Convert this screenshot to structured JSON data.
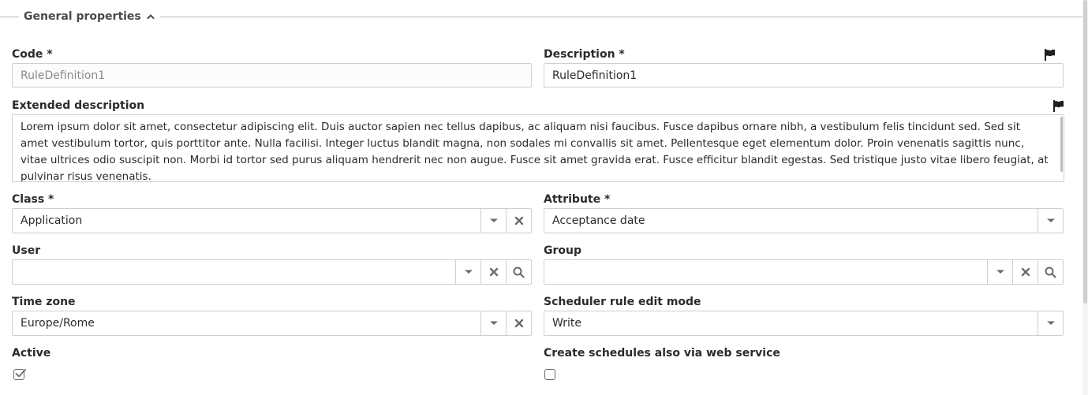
{
  "section": {
    "title": "General properties"
  },
  "fields": {
    "code": {
      "label": "Code *",
      "value": "RuleDefinition1"
    },
    "description": {
      "label": "Description *",
      "value": "RuleDefinition1"
    },
    "extended_description": {
      "label": "Extended description",
      "value": "Lorem ipsum dolor sit amet, consectetur adipiscing elit. Duis auctor sapien nec tellus dapibus, ac aliquam nisi faucibus. Fusce dapibus ornare nibh, a vestibulum felis tincidunt sed. Sed sit amet vestibulum tortor, quis porttitor ante. Nulla facilisi. Integer luctus blandit magna, non sodales mi convallis sit amet. Pellentesque eget elementum dolor. Proin venenatis sagittis nunc, vitae ultrices odio suscipit non. Morbi id tortor sed purus aliquam hendrerit nec non augue. Fusce sit amet gravida erat. Fusce efficitur blandit egestas. Sed tristique justo vitae libero feugiat, at pulvinar risus venenatis."
    },
    "class": {
      "label": "Class *",
      "value": "Application"
    },
    "attribute": {
      "label": "Attribute *",
      "value": "Acceptance date"
    },
    "user": {
      "label": "User",
      "value": ""
    },
    "group": {
      "label": "Group",
      "value": ""
    },
    "time_zone": {
      "label": "Time zone",
      "value": "Europe/Rome"
    },
    "scheduler_rule_edit_mode": {
      "label": "Scheduler rule edit mode",
      "value": "Write"
    },
    "active": {
      "label": "Active",
      "checked": true
    },
    "create_schedules_web_service": {
      "label": "Create schedules also via web service",
      "checked": false
    }
  },
  "icons": {
    "flag": "flag-icon",
    "dropdown": "chevron-down-icon",
    "clear": "close-icon",
    "search": "search-icon",
    "collapse": "chevron-up-icon",
    "check": "check-icon"
  },
  "colors": {
    "border": "#cfcfcf",
    "text": "#2b2b2b",
    "icon": "#6b6b6b",
    "flag": "#1f1f1f"
  }
}
